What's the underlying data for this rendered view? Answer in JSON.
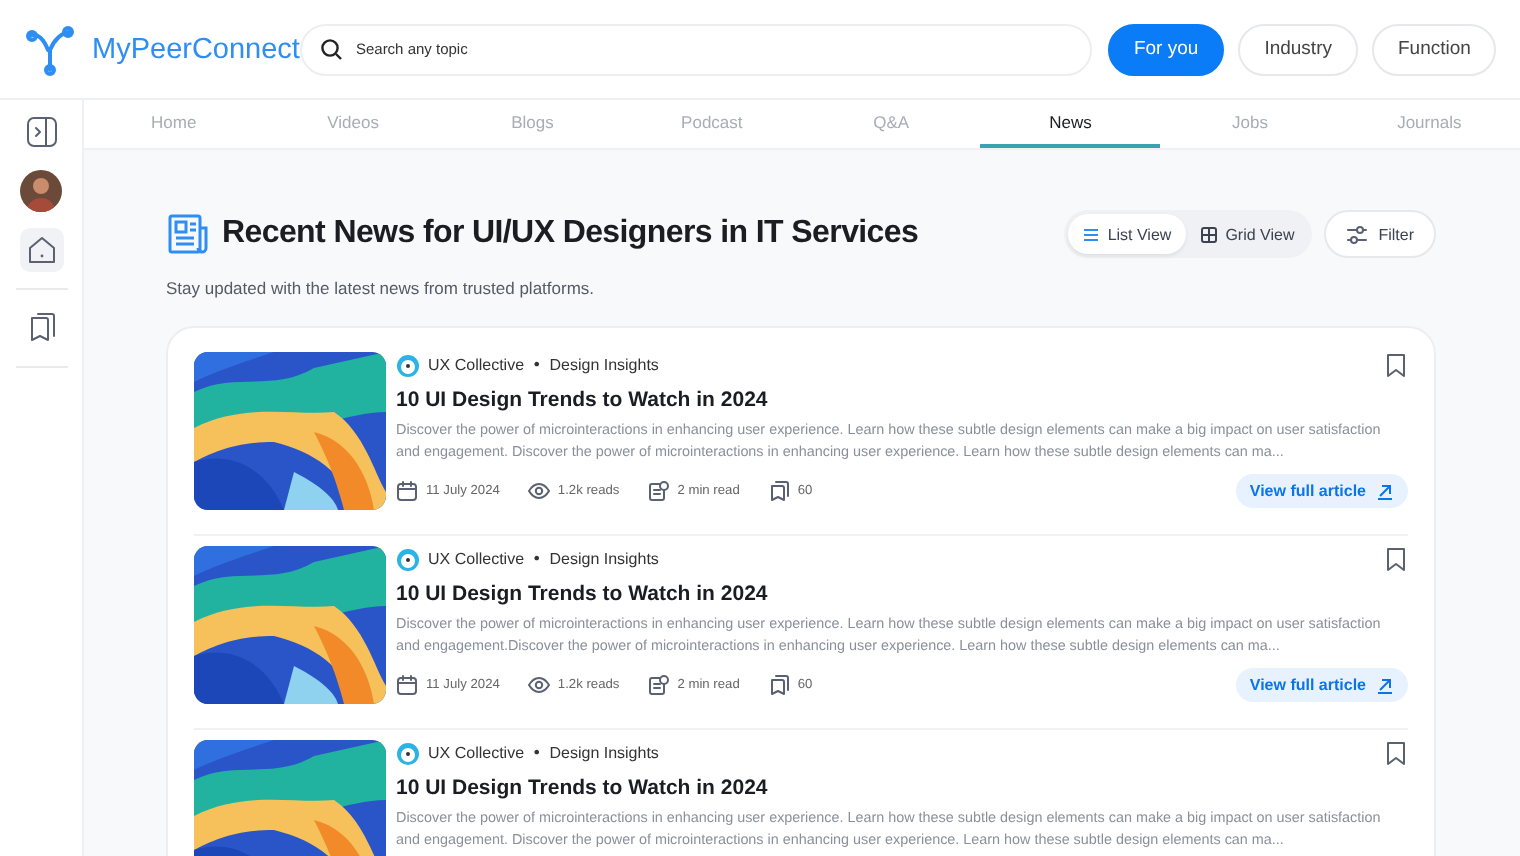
{
  "header": {
    "brand": "MyPeerConnect",
    "search": {
      "placeholder": "Search any topic"
    },
    "filters": [
      {
        "label": "For you",
        "selected": true
      },
      {
        "label": "Industry",
        "selected": false
      },
      {
        "label": "Function",
        "selected": false
      }
    ]
  },
  "sidebar": {
    "items": [
      {
        "kind": "toggle"
      },
      {
        "kind": "avatar"
      },
      {
        "kind": "home",
        "selected": true
      },
      {
        "kind": "divider"
      },
      {
        "kind": "library",
        "selected": false
      },
      {
        "kind": "divider"
      }
    ]
  },
  "tabs": [
    {
      "label": "Home",
      "selected": false
    },
    {
      "label": "Videos",
      "selected": false
    },
    {
      "label": "Blogs",
      "selected": false
    },
    {
      "label": "Podcast",
      "selected": false
    },
    {
      "label": "Q&A",
      "selected": false
    },
    {
      "label": "News",
      "selected": true
    },
    {
      "label": "Jobs",
      "selected": false
    },
    {
      "label": "Journals",
      "selected": false
    }
  ],
  "page": {
    "title": "Recent News for UI/UX Designers in IT Services",
    "subtitle": "Stay updated with the latest news from trusted platforms.",
    "views": [
      {
        "label": "List View",
        "kind": "list",
        "selected": true
      },
      {
        "label": "Grid View",
        "kind": "grid",
        "selected": false
      }
    ],
    "filter_button": "Filter"
  },
  "articles": [
    {
      "source": "UX Collective",
      "separator": "•",
      "category": "Design Insights",
      "title": "10 UI Design Trends to Watch in 2024",
      "description": "Discover the power of microinteractions in enhancing user experience. Learn how these subtle design elements can make a big impact on user satisfaction and engagement. Discover the power of microinteractions in enhancing user experience. Learn how these subtle design elements can ma...",
      "date": "11 July 2024",
      "reads": "1.2k reads",
      "read_time": "2 min read",
      "saves": "60",
      "link": "View full article"
    },
    {
      "source": "UX Collective",
      "separator": "•",
      "category": "Design Insights",
      "title": "10 UI Design Trends to Watch in 2024",
      "description": "Discover the power of microinteractions in enhancing user experience. Learn how these subtle design elements can make a big impact on user satisfaction and engagement.Discover the power of microinteractions in enhancing user experience. Learn how these subtle design elements can ma...",
      "date": "11 July 2024",
      "reads": "1.2k reads",
      "read_time": "2 min read",
      "saves": "60",
      "link": "View full article"
    },
    {
      "source": "UX Collective",
      "separator": "•",
      "category": "Design Insights",
      "title": "10 UI Design Trends to Watch in 2024",
      "description": "Discover the power of microinteractions in enhancing user experience. Learn how these subtle design elements can make a big impact on user satisfaction and engagement. Discover the power of microinteractions in enhancing user experience. Learn how these subtle design elements can ma..."
    }
  ]
}
